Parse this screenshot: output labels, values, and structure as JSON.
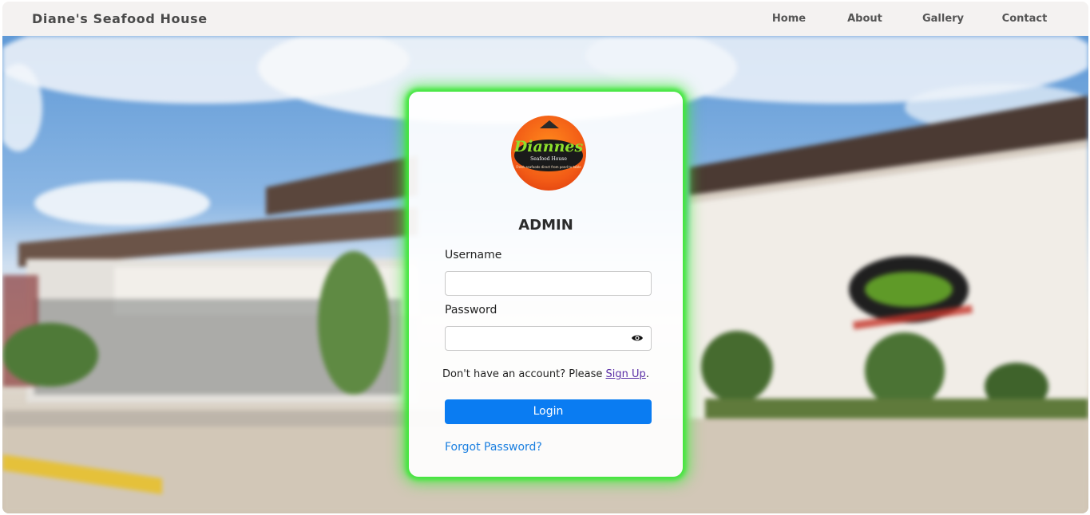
{
  "navbar": {
    "brand": "Diane's Seafood House",
    "links": [
      "Home",
      "About",
      "Gallery",
      "Contact"
    ]
  },
  "login": {
    "logo": {
      "script_text": "Diannes",
      "sub_text": "Seafood House",
      "tagline": "Fresh seafoods direct from pond to table"
    },
    "title": "ADMIN",
    "username_label": "Username",
    "username_value": "",
    "password_label": "Password",
    "password_value": "",
    "signup_prefix": "Don't have an account? Please ",
    "signup_link": "Sign Up",
    "signup_suffix": ".",
    "login_button": "Login",
    "forgot_link": "Forgot Password?"
  },
  "colors": {
    "card_glow": "#3fe63a",
    "login_button": "#0a7cf2",
    "forgot_link": "#1a7fe0",
    "signup_link": "#5a2ea6"
  },
  "icons": [
    "eye-icon",
    "restaurant-logo"
  ]
}
